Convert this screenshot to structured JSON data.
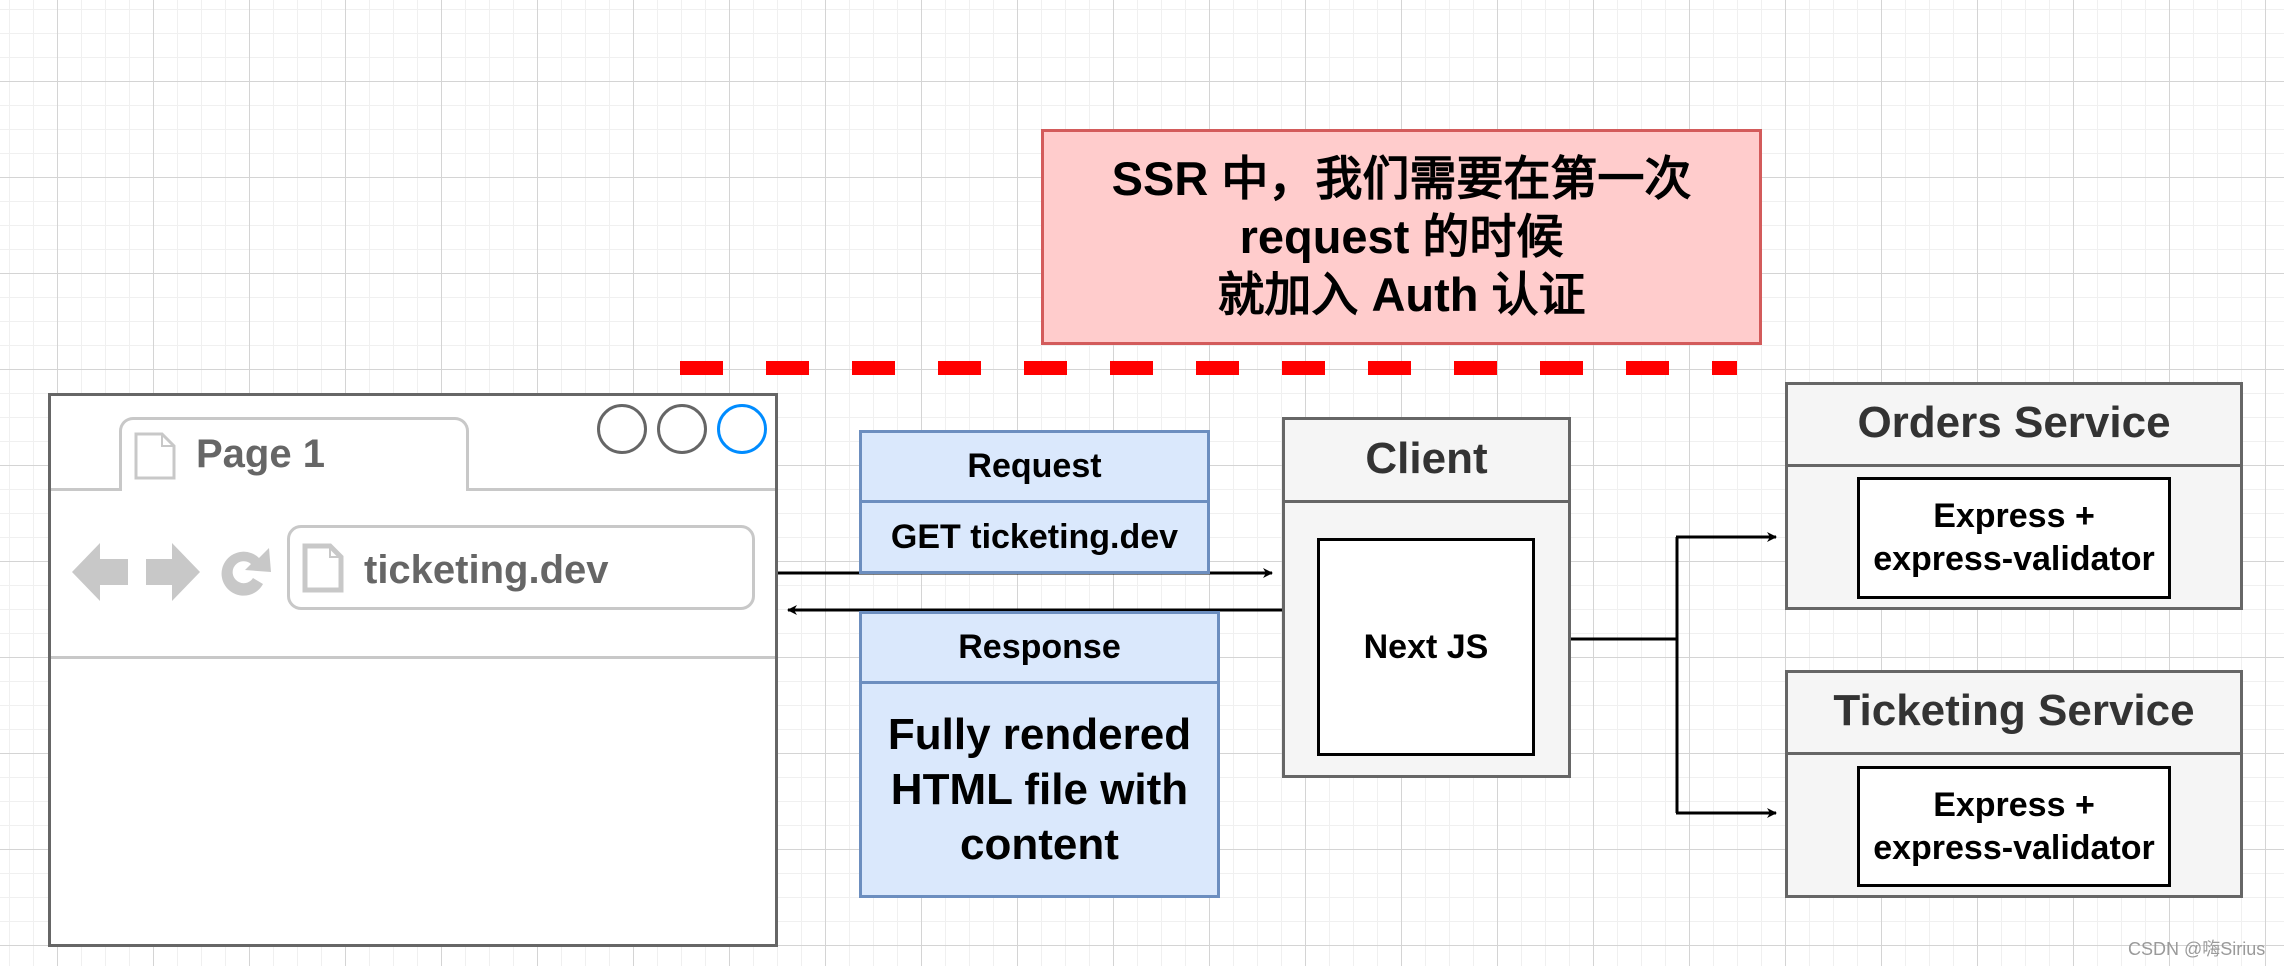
{
  "note": {
    "lines": [
      "SSR 中，我们需要在第一次",
      "request 的时候",
      "就加入 Auth 认证"
    ],
    "fill_color": "#ffcccc",
    "border_color": "#d35b5b",
    "divider_color": "#ff0000"
  },
  "browser": {
    "tab_label": "Page 1",
    "address": "ticketing.dev",
    "nav_icons": [
      "back-arrow-icon",
      "forward-arrow-icon",
      "refresh-icon"
    ],
    "window_controls": [
      "circle",
      "circle",
      "circle-active"
    ],
    "active_control_color": "#008cff"
  },
  "request": {
    "title": "Request",
    "body": "GET ticketing.dev"
  },
  "response": {
    "title": "Response",
    "body_lines": [
      "Fully rendered",
      "HTML file with",
      "content"
    ]
  },
  "client": {
    "title": "Client",
    "inner": "Next JS"
  },
  "services": [
    {
      "title": "Orders Service",
      "inner_lines": [
        "Express +",
        "express-validator"
      ]
    },
    {
      "title": "Ticketing Service",
      "inner_lines": [
        "Express +",
        "express-validator"
      ]
    }
  ],
  "colors": {
    "blue_fill": "#dae8fc",
    "blue_border": "#6c8ebf",
    "gray_fill": "#f5f5f5",
    "gray_border": "#666666"
  },
  "watermark": "CSDN @嗨Sirius"
}
